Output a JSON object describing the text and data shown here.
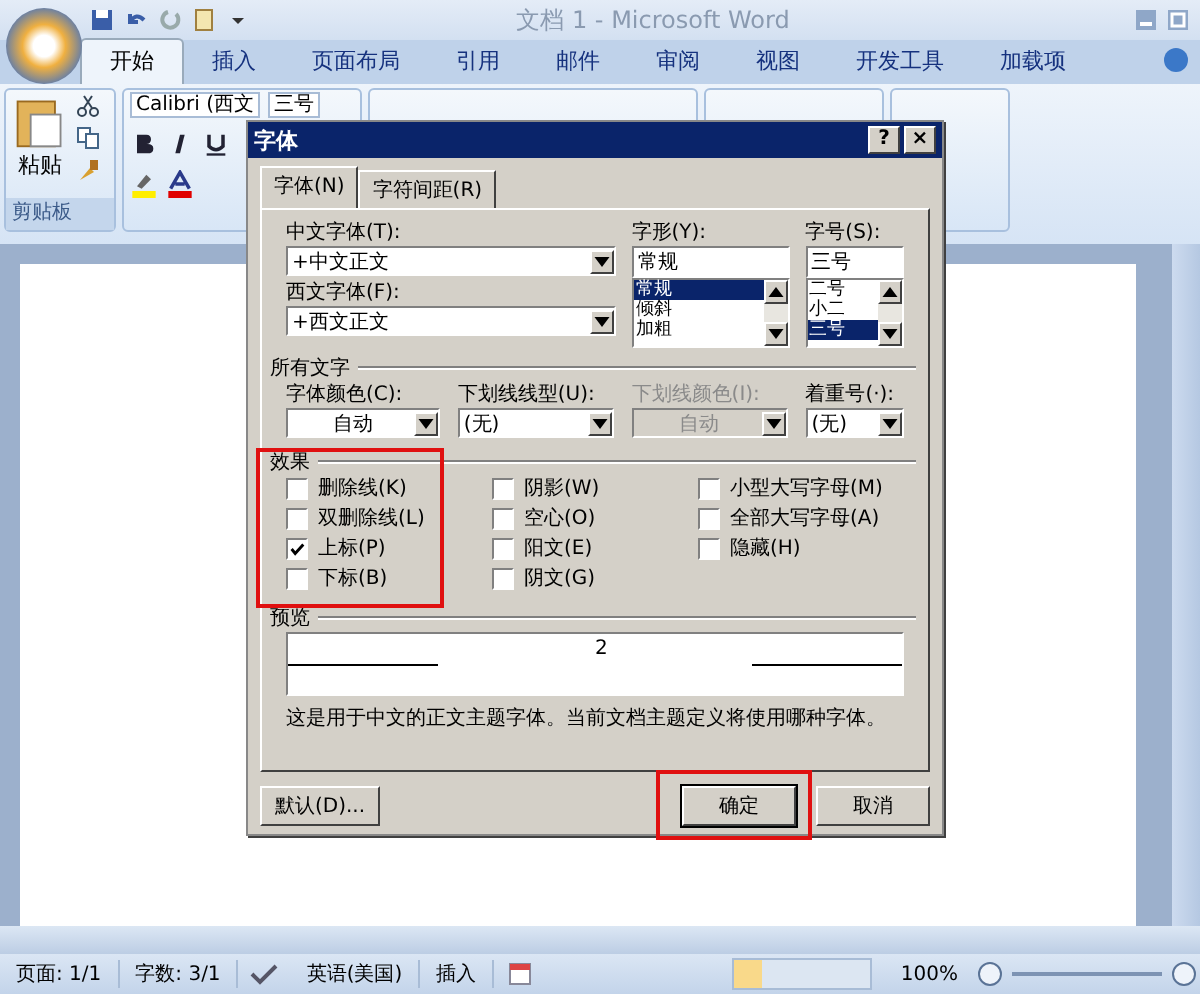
{
  "window": {
    "title": "文档 1 - Microsoft Word"
  },
  "ribbon_tabs": [
    {
      "label": "开始",
      "selected": true
    },
    {
      "label": "插入",
      "selected": false
    },
    {
      "label": "页面布局",
      "selected": false
    },
    {
      "label": "引用",
      "selected": false
    },
    {
      "label": "邮件",
      "selected": false
    },
    {
      "label": "审阅",
      "selected": false
    },
    {
      "label": "视图",
      "selected": false
    },
    {
      "label": "开发工具",
      "selected": false
    },
    {
      "label": "加载项",
      "selected": false
    }
  ],
  "ribbon": {
    "paste_label": "粘贴",
    "clipboard_group": "剪贴板",
    "font_name": "Calibri (西文",
    "font_size": "三号"
  },
  "dialog": {
    "title": "字体",
    "help": "?",
    "close": "×",
    "tabs": [
      {
        "label": "字体(N)",
        "selected": true
      },
      {
        "label": "字符间距(R)",
        "selected": false
      }
    ],
    "chinese_font": {
      "label": "中文字体(T):",
      "value": "+中文正文"
    },
    "western_font": {
      "label": "西文字体(F):",
      "value": "+西文正文"
    },
    "style": {
      "label": "字形(Y):",
      "value": "常规",
      "options": [
        {
          "label": "常规",
          "selected": true
        },
        {
          "label": "倾斜",
          "selected": false
        },
        {
          "label": "加粗",
          "selected": false
        }
      ]
    },
    "size": {
      "label": "字号(S):",
      "value": "三号",
      "options": [
        {
          "label": "二号",
          "selected": false
        },
        {
          "label": "小二",
          "selected": false
        },
        {
          "label": "三号",
          "selected": true
        }
      ]
    },
    "all_text_heading": "所有文字",
    "all_text": [
      {
        "label": "字体颜色(C):",
        "value": "自动",
        "disabled": false,
        "kind": "centered"
      },
      {
        "label": "下划线线型(U):",
        "value": "(无)",
        "disabled": false,
        "kind": "left"
      },
      {
        "label": "下划线颜色(I):",
        "value": "自动",
        "disabled": true,
        "kind": "centered"
      },
      {
        "label": "着重号(·):",
        "value": "(无)",
        "disabled": false,
        "kind": "left"
      }
    ],
    "effects_heading": "效果",
    "effects": [
      [
        {
          "label": "删除线(K)",
          "checked": false
        },
        {
          "label": "双删除线(L)",
          "checked": false
        },
        {
          "label": "上标(P)",
          "checked": true
        },
        {
          "label": "下标(B)",
          "checked": false
        }
      ],
      [
        {
          "label": "阴影(W)",
          "checked": false
        },
        {
          "label": "空心(O)",
          "checked": false
        },
        {
          "label": "阳文(E)",
          "checked": false
        },
        {
          "label": "阴文(G)",
          "checked": false
        }
      ],
      [
        {
          "label": "小型大写字母(M)",
          "checked": false
        },
        {
          "label": "全部大写字母(A)",
          "checked": false
        },
        {
          "label": "隐藏(H)",
          "checked": false
        }
      ]
    ],
    "preview_heading": "预览",
    "preview_text": "2",
    "preview_note": "这是用于中文的正文主题字体。当前文档主题定义将使用哪种字体。",
    "buttons": [
      {
        "label": "默认(D)...",
        "kind": "default"
      },
      {
        "label": "确定",
        "kind": "ok"
      },
      {
        "label": "取消",
        "kind": "cancel"
      }
    ]
  },
  "status_bar": {
    "page": "页面: 1/1",
    "words": "字数: 3/1",
    "language": "英语(美国)",
    "mode": "插入",
    "zoom": "100%"
  }
}
